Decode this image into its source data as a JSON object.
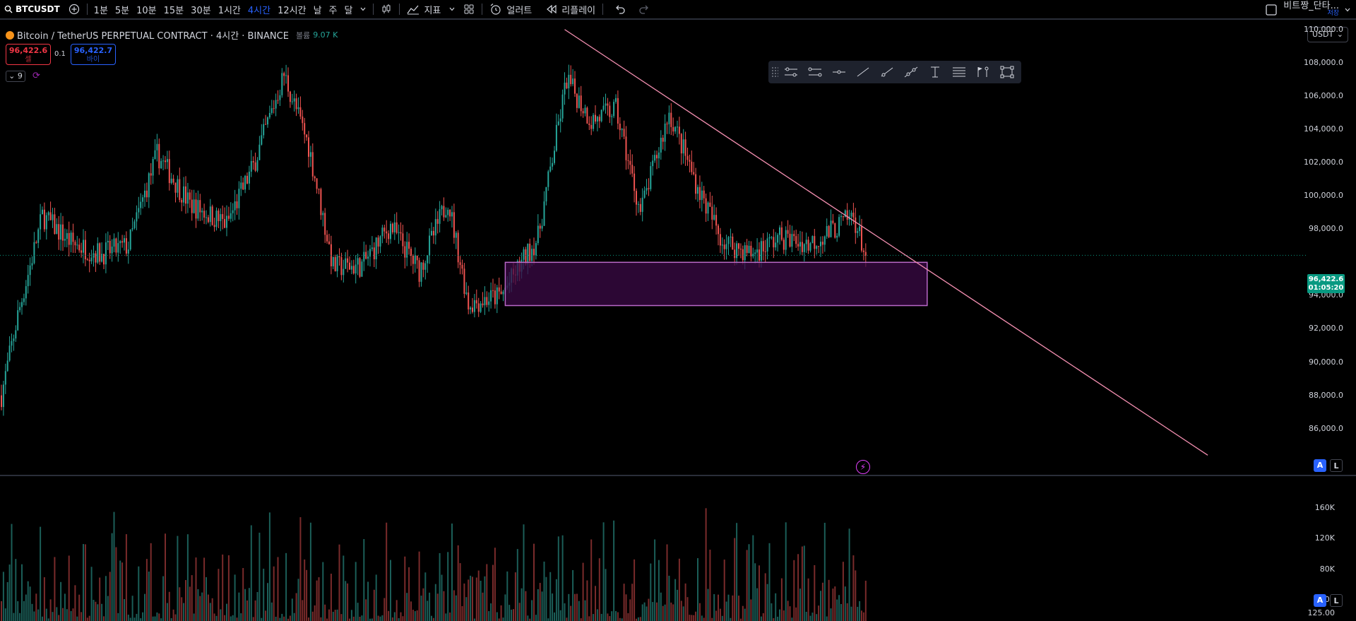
{
  "toolbar": {
    "symbol": "BTCUSDT",
    "timeframes": [
      {
        "label": "1분",
        "active": false
      },
      {
        "label": "5분",
        "active": false
      },
      {
        "label": "10분",
        "active": false
      },
      {
        "label": "15분",
        "active": false
      },
      {
        "label": "30분",
        "active": false
      },
      {
        "label": "1시간",
        "active": false
      },
      {
        "label": "4시간",
        "active": true
      },
      {
        "label": "12시간",
        "active": false
      },
      {
        "label": "날",
        "active": false
      },
      {
        "label": "주",
        "active": false
      },
      {
        "label": "달",
        "active": false
      }
    ],
    "indicators_label": "지표",
    "alert_label": "얼러트",
    "replay_label": "리플레이",
    "layout_name": "비트짱_단타...",
    "layout_status": "저장"
  },
  "legend": {
    "title": "Bitcoin / TetherUS PERPETUAL CONTRACT · 4시간 · BINANCE",
    "volume_label": "볼륨",
    "volume_value": "9.07 K"
  },
  "trade": {
    "sell_price": "96,422.6",
    "sell_label": "셀",
    "spread": "0.1",
    "buy_price": "96,422.7",
    "buy_label": "바이"
  },
  "indicator_count": "9",
  "axis": {
    "currency": "USDT",
    "price_ticks": [
      "110,000.0",
      "108,000.0",
      "106,000.0",
      "104,000.0",
      "102,000.0",
      "100,000.0",
      "98,000.0",
      "94,000.0",
      "92,000.0",
      "90,000.0",
      "88,000.0",
      "86,000.0"
    ],
    "current_price": "96,422.6",
    "countdown": "01:05:20",
    "volume_ticks": [
      "160K",
      "120K",
      "80K",
      "40K"
    ],
    "volume_bottom": "125.00",
    "auto_label": "A",
    "log_label": "L"
  },
  "colors": {
    "up": "#26a69a",
    "down": "#ef5350",
    "trendline": "#f48fb1",
    "zone_fill": "#3b0a45",
    "zone_stroke": "#ba68c8",
    "price_tag": "#089981",
    "accent": "#2962ff"
  },
  "chart_data": {
    "type": "candlestick",
    "symbol": "BTCUSDT",
    "timeframe": "4시간",
    "ylim": [
      84500,
      110500
    ],
    "current_price": 96422.6,
    "anchors": [
      {
        "i": 0,
        "p": 88000
      },
      {
        "i": 8,
        "p": 92800
      },
      {
        "i": 20,
        "p": 98800
      },
      {
        "i": 34,
        "p": 97200
      },
      {
        "i": 48,
        "p": 96500
      },
      {
        "i": 62,
        "p": 97000
      },
      {
        "i": 76,
        "p": 102500
      },
      {
        "i": 92,
        "p": 99500
      },
      {
        "i": 110,
        "p": 98300
      },
      {
        "i": 123,
        "p": 101800
      },
      {
        "i": 138,
        "p": 107300
      },
      {
        "i": 150,
        "p": 103000
      },
      {
        "i": 162,
        "p": 95700
      },
      {
        "i": 176,
        "p": 95800
      },
      {
        "i": 190,
        "p": 98200
      },
      {
        "i": 204,
        "p": 95500
      },
      {
        "i": 218,
        "p": 99800
      },
      {
        "i": 228,
        "p": 93500
      },
      {
        "i": 244,
        "p": 94000
      },
      {
        "i": 262,
        "p": 97500
      },
      {
        "i": 276,
        "p": 107000
      },
      {
        "i": 288,
        "p": 104500
      },
      {
        "i": 300,
        "p": 105200
      },
      {
        "i": 312,
        "p": 99000
      },
      {
        "i": 326,
        "p": 105000
      },
      {
        "i": 340,
        "p": 100500
      },
      {
        "i": 352,
        "p": 97300
      },
      {
        "i": 366,
        "p": 96500
      },
      {
        "i": 380,
        "p": 97500
      },
      {
        "i": 394,
        "p": 97100
      },
      {
        "i": 404,
        "p": 97800
      },
      {
        "i": 416,
        "p": 98800
      },
      {
        "i": 422,
        "p": 96400
      }
    ],
    "trendline": [
      {
        "i": 275,
        "p": 110000
      },
      {
        "i": 589,
        "p": 84400
      }
    ],
    "zone": {
      "i_start": 246,
      "i_end": 452,
      "p_high": 96000,
      "p_low": 93400
    },
    "volume_ylim": [
      0,
      200000
    ]
  }
}
